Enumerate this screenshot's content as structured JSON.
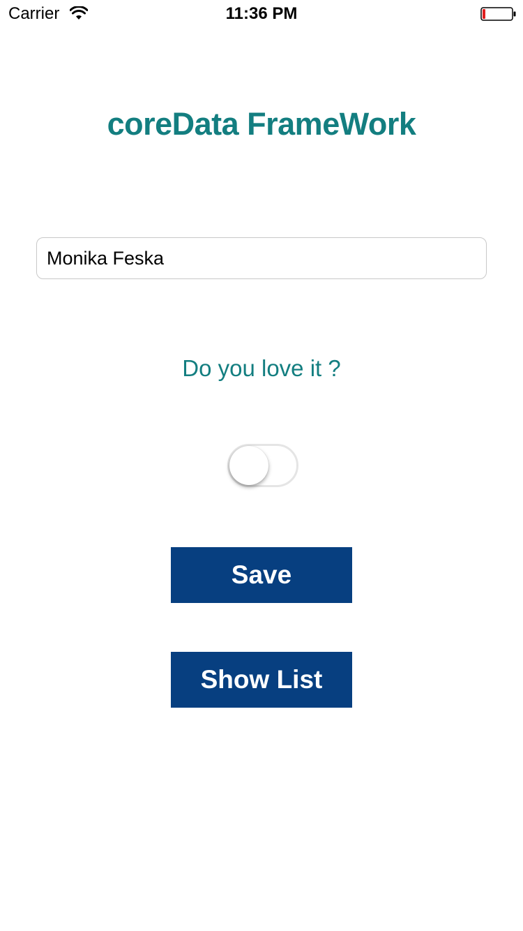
{
  "status_bar": {
    "carrier": "Carrier",
    "time": "11:36 PM",
    "wifi_icon": "wifi-icon",
    "battery_icon": "battery-low-icon",
    "battery_level": 0.1,
    "battery_color": "#e02020"
  },
  "header": {
    "title": "coreData FrameWork"
  },
  "form": {
    "name_value": "Monika Feska",
    "question": "Do you love it ?",
    "love_toggle_on": false
  },
  "actions": {
    "save_label": "Save",
    "show_list_label": "Show List"
  },
  "colors": {
    "accent": "#137e80",
    "button": "#073f80"
  }
}
